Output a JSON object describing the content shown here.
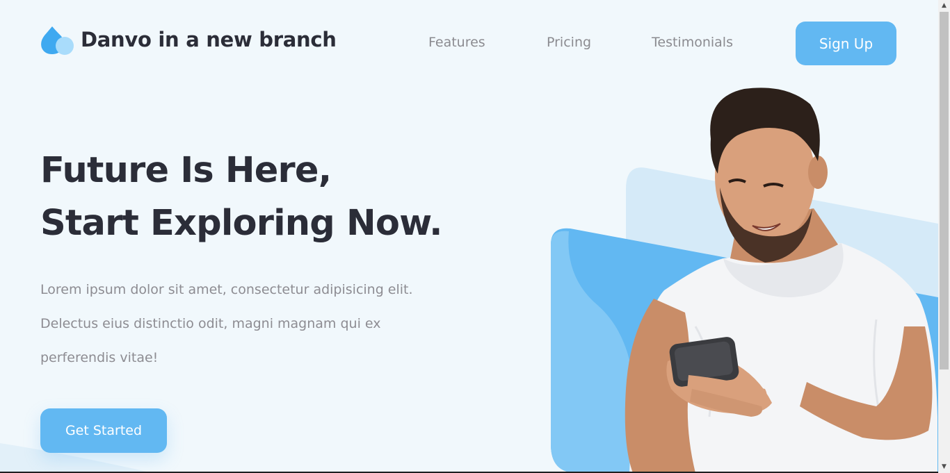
{
  "header": {
    "brand_name": "Danvo in a new branch",
    "logo_icon": "water-drops-icon",
    "nav": [
      {
        "label": "Features"
      },
      {
        "label": "Pricing"
      },
      {
        "label": "Testimonials"
      }
    ],
    "signup_label": "Sign Up"
  },
  "hero": {
    "headline_line1": "Future Is Here,",
    "headline_line2": "Start Exploring Now.",
    "lead_lines": [
      "Lorem ipsum dolor sit amet, consectetur adipisicing elit.",
      "Delectus eius distinctio odit, magni magnam qui ex",
      "perferendis vitae!"
    ],
    "cta_label": "Get Started",
    "image": "man-holding-smartphone-photo"
  },
  "colors": {
    "accent": "#62b8f2",
    "background": "#f1f8fc",
    "heading": "#2b2d38",
    "muted": "#8d8c92",
    "pale_shape": "#d5eaf8"
  },
  "scrollbar": {
    "up_icon": "scroll-up-arrow-icon",
    "down_icon": "scroll-down-arrow-icon"
  }
}
